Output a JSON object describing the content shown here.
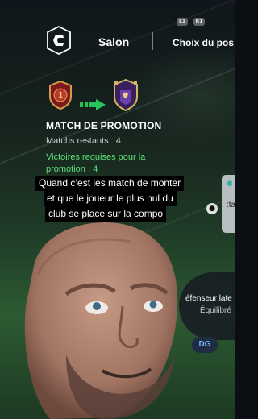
{
  "header": {
    "hints": [
      "L1",
      "R1"
    ],
    "logo_icon": "fc-logo-icon",
    "tabs": [
      {
        "label": "Salon"
      },
      {
        "label": "Choix du pos"
      }
    ]
  },
  "promotion": {
    "from_division": "1",
    "title": "MATCH DE PROMOTION",
    "matches_left": "Matchs restants : 4",
    "wins_required_1": "Victoires requises pour la",
    "wins_required_2": "promotion : 4",
    "arrow_color": "#27c35a"
  },
  "side_card": {
    "line1": "✱",
    "line2": ":ta"
  },
  "player": {
    "role": "éfenseur late",
    "style": "Équilibré",
    "position": "DG"
  },
  "caption": {
    "line1": "Quand c’est les match de monter",
    "line2": "et que le joueur le plus nul du",
    "line3": "club se place sur la compo"
  }
}
